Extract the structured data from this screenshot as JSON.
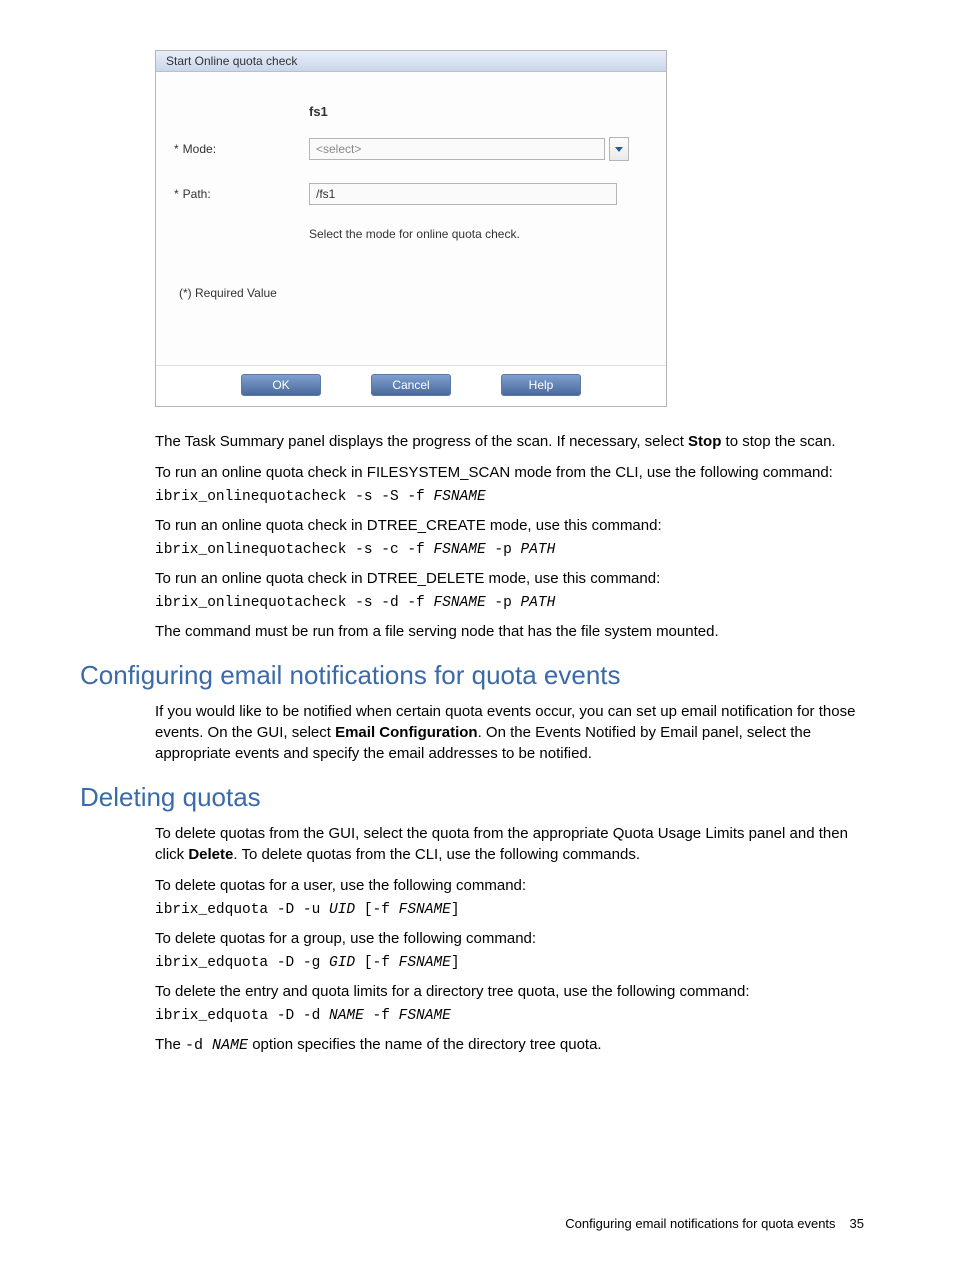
{
  "dialog": {
    "title": "Start Online quota check",
    "heading": "fs1",
    "mode_label": "Mode:",
    "mode_placeholder": "<select>",
    "path_label": "Path:",
    "path_value": "/fs1",
    "helper": "Select the mode for online quota check.",
    "required_note": "(*) Required Value",
    "ok": "OK",
    "cancel": "Cancel",
    "help": "Help"
  },
  "para1a": "The Task Summary panel displays the progress of the scan. If necessary, select ",
  "para1_bold": "Stop",
  "para1b": " to stop the scan.",
  "para2": "To run an online quota check in FILESYSTEM_SCAN mode from the CLI, use the following command:",
  "cmd1a": "ibrix_onlinequotacheck -s -S -f ",
  "cmd1b": "FSNAME",
  "para3": "To run an online quota check in DTREE_CREATE mode, use this command:",
  "cmd2a": "ibrix_onlinequotacheck -s -c -f ",
  "cmd2b": "FSNAME",
  "cmd2c": " -p ",
  "cmd2d": "PATH",
  "para4": "To run an online quota check in DTREE_DELETE mode, use this command:",
  "cmd3a": "ibrix_onlinequotacheck -s -d -f ",
  "cmd3b": "FSNAME",
  "cmd3c": " -p ",
  "cmd3d": "PATH",
  "para5": "The command must be run from a file serving node that has the file system mounted.",
  "h2_a": "Configuring email notifications for quota events",
  "para6a": "If you would like to be notified when certain quota events occur, you can set up email notification for those events. On the GUI, select ",
  "para6_bold": "Email Configuration",
  "para6b": ". On the Events Notified by Email panel, select the appropriate events and specify the email addresses to be notified.",
  "h2_b": "Deleting quotas",
  "para7a": "To delete quotas from the GUI, select the quota from the appropriate Quota Usage Limits panel and then click ",
  "para7_bold": "Delete",
  "para7b": ". To delete quotas from the CLI, use the following commands.",
  "para8": "To delete quotas for a user, use the following command:",
  "cmd4a": "ibrix_edquota -D -u ",
  "cmd4b": "UID",
  "cmd4c": " [-f ",
  "cmd4d": "FSNAME",
  "cmd4e": "]",
  "para9": "To delete quotas for a group, use the following command:",
  "cmd5a": "ibrix_edquota -D -g ",
  "cmd5b": "GID",
  "cmd5c": " [-f ",
  "cmd5d": "FSNAME",
  "cmd5e": "]",
  "para10": "To delete the entry and quota limits for a directory tree quota, use the following command:",
  "cmd6a": "ibrix_edquota -D -d ",
  "cmd6b": "NAME",
  "cmd6c": " -f ",
  "cmd6d": "FSNAME",
  "para11a": "The ",
  "para11m1": "-d ",
  "para11m2": "NAME",
  "para11b": " option specifies the name of the directory tree quota.",
  "footer_text": "Configuring email notifications for quota events",
  "footer_page": "35"
}
